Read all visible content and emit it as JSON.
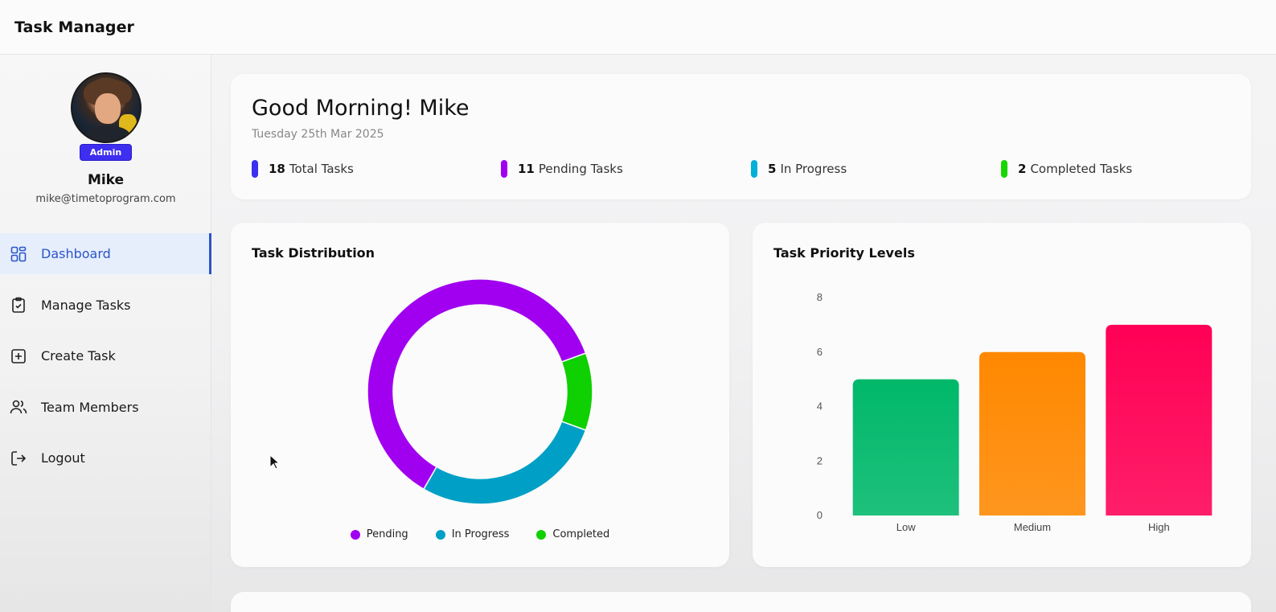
{
  "app": {
    "title": "Task Manager"
  },
  "profile": {
    "role": "Admin",
    "name": "Mike",
    "email": "mike@timetoprogram.com"
  },
  "nav": {
    "items": [
      {
        "label": "Dashboard",
        "icon": "dashboard-icon",
        "active": true
      },
      {
        "label": "Manage Tasks",
        "icon": "clipboard-check-icon",
        "active": false
      },
      {
        "label": "Create Task",
        "icon": "plus-square-icon",
        "active": false
      },
      {
        "label": "Team Members",
        "icon": "users-icon",
        "active": false
      },
      {
        "label": "Logout",
        "icon": "logout-icon",
        "active": false
      }
    ]
  },
  "greeting": {
    "title": "Good Morning! Mike",
    "date": "Tuesday 25th Mar 2025",
    "stats": [
      {
        "value": "18",
        "label": "Total Tasks",
        "color": "#3b2ff0"
      },
      {
        "value": "11",
        "label": "Pending Tasks",
        "color": "#a100f0"
      },
      {
        "value": "5",
        "label": "In Progress",
        "color": "#00b0d8"
      },
      {
        "value": "2",
        "label": "Completed Tasks",
        "color": "#16d600"
      }
    ]
  },
  "distribution": {
    "title": "Task Distribution"
  },
  "priority": {
    "title": "Task Priority Levels"
  },
  "chart_data": [
    {
      "type": "pie",
      "title": "Task Distribution",
      "donut": true,
      "categories": [
        "Pending",
        "In Progress",
        "Completed"
      ],
      "values": [
        11,
        5,
        2
      ],
      "colors": [
        "#a100f0",
        "#00a0c6",
        "#0fd000"
      ],
      "legend": "bottom"
    },
    {
      "type": "bar",
      "title": "Task Priority Levels",
      "categories": [
        "Low",
        "Medium",
        "High"
      ],
      "values": [
        5,
        6,
        7
      ],
      "colors": [
        "#00b86a",
        "#ff8800",
        "#ff0055"
      ],
      "ylim": [
        0,
        8
      ],
      "yticks": [
        0,
        2,
        4,
        6,
        8
      ],
      "grid": false
    }
  ]
}
